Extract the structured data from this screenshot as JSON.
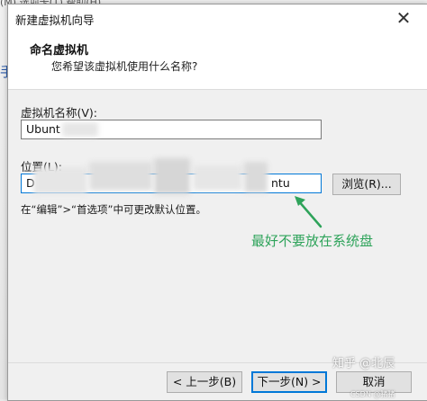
{
  "window": {
    "title": "新建虚拟机向导",
    "close_glyph": "✕"
  },
  "background": {
    "menu_fragment": "(M)  选项卡(T)  帮助(H)",
    "side_glyph": "手"
  },
  "header": {
    "title": "命名虚拟机",
    "subtitle": "您希望该虚拟机使用什么名称?"
  },
  "form": {
    "name_label": "虚拟机名称(V):",
    "name_value": "Ubunt",
    "location_label": "位置(L):",
    "location_value_start": "D",
    "location_value_end": "ntu",
    "browse_label": "浏览(R)...",
    "hint": "在“编辑”>“首选项”中可更改默认位置。"
  },
  "annotation": {
    "text": "最好不要放在系统盘",
    "color": "#2ea35a"
  },
  "footer": {
    "back_label": "< 上一步(B)",
    "next_label": "下一步(N) >",
    "cancel_label": "取消"
  },
  "watermark": {
    "main": "知乎 @北辰",
    "small": "CSDN @猪猪"
  }
}
